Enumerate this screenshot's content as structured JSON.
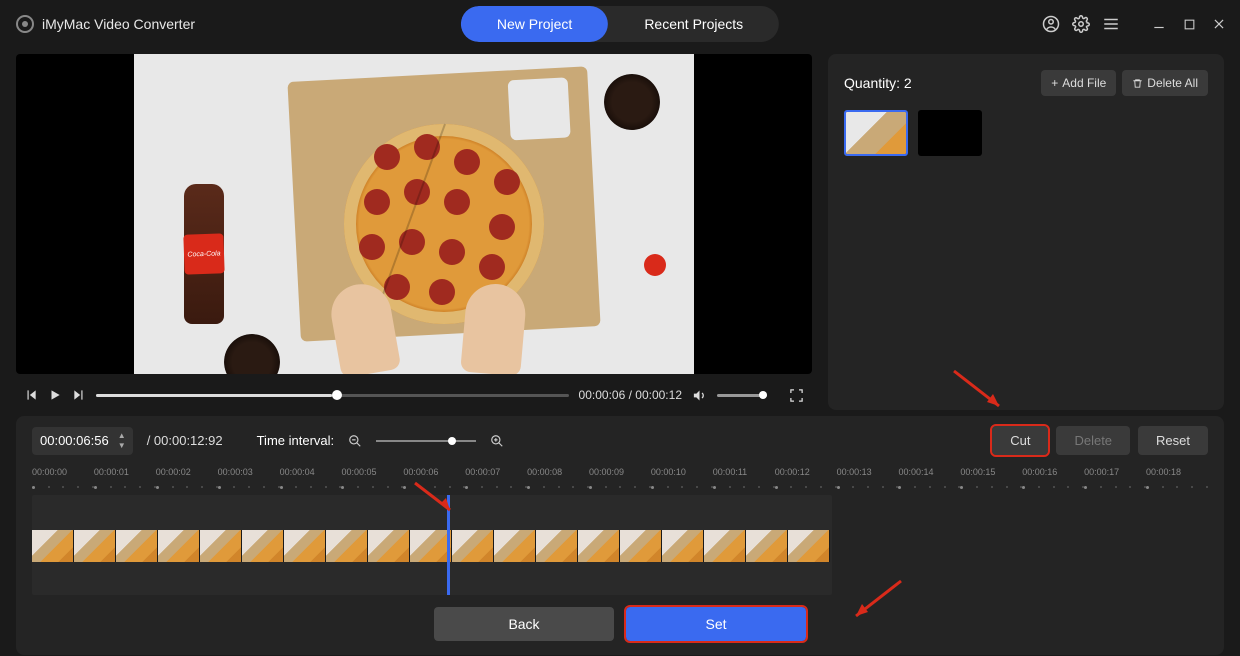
{
  "app": {
    "title": "iMyMac Video Converter"
  },
  "tabs": {
    "new_project": "New Project",
    "recent_projects": "Recent Projects"
  },
  "player": {
    "current_time": "00:00:06",
    "total_time": "00:00:12",
    "progress_pct": 50
  },
  "side": {
    "quantity_label": "Quantity:",
    "quantity_value": "2",
    "add_file": "Add File",
    "delete_all": "Delete All"
  },
  "editor": {
    "time_value": "00:00:06:56",
    "total": "/ 00:00:12:92",
    "interval_label": "Time interval:",
    "cut": "Cut",
    "delete": "Delete",
    "reset": "Reset",
    "back": "Back",
    "set": "Set",
    "playhead_pct": 52
  },
  "ruler": [
    "00:00:00",
    "00:00:01",
    "00:00:02",
    "00:00:03",
    "00:00:04",
    "00:00:05",
    "00:00:06",
    "00:00:07",
    "00:00:08",
    "00:00:09",
    "00:00:10",
    "00:00:11",
    "00:00:12",
    "00:00:13",
    "00:00:14",
    "00:00:15",
    "00:00:16",
    "00:00:17",
    "00:00:18"
  ],
  "bottle_label": "Coca-Cola"
}
